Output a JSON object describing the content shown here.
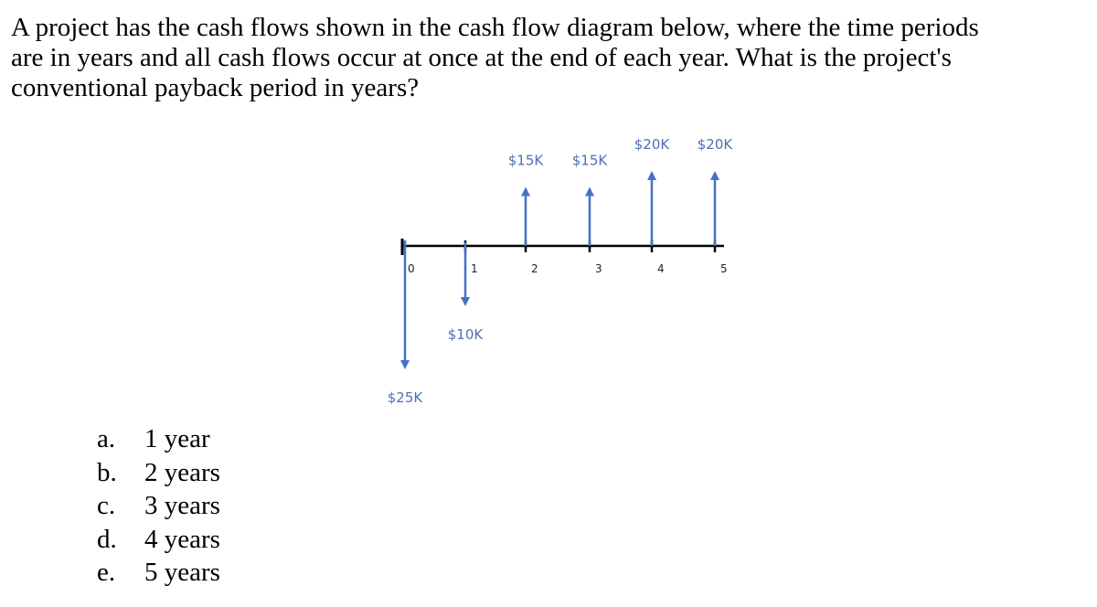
{
  "question": {
    "lines": [
      "A project has the cash flows shown in the cash flow diagram below, where the time periods",
      "are in years and all cash flows occur at once at the end of each year.  What is the project's",
      "conventional payback period in years?"
    ]
  },
  "diagram": {
    "type": "cash-flow-diagram",
    "arrow_color": "#4472c4",
    "label_color": "#4f6fb8",
    "axis_color": "#000000",
    "periods": [
      "0",
      "1",
      "2",
      "3",
      "4",
      "5"
    ],
    "cash_flows": [
      {
        "period": 0,
        "amount": -25,
        "label": "$25K",
        "direction": "down"
      },
      {
        "period": 1,
        "amount": -10,
        "label": "$10K",
        "direction": "down"
      },
      {
        "period": 2,
        "amount": 15,
        "label": "$15K",
        "direction": "up"
      },
      {
        "period": 3,
        "amount": 15,
        "label": "$15K",
        "direction": "up"
      },
      {
        "period": 4,
        "amount": 20,
        "label": "$20K",
        "direction": "up"
      },
      {
        "period": 5,
        "amount": 20,
        "label": "$20K",
        "direction": "up"
      }
    ]
  },
  "options": [
    {
      "letter": "a.",
      "text": "1 year"
    },
    {
      "letter": "b.",
      "text": "2 years"
    },
    {
      "letter": "c.",
      "text": "3 years"
    },
    {
      "letter": "d.",
      "text": "4 years"
    },
    {
      "letter": "e.",
      "text": "5 years"
    }
  ]
}
